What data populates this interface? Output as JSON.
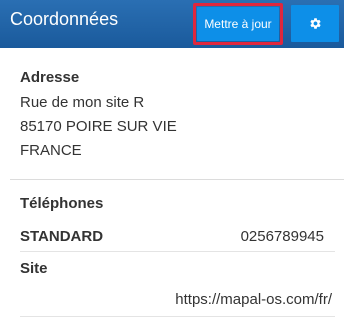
{
  "header": {
    "title": "Coordonnées",
    "update_label": "Mettre à jour",
    "settings_icon": "gear-icon"
  },
  "address": {
    "title": "Adresse",
    "lines": [
      "Rue de mon site R",
      "85170 POIRE SUR VIE",
      "FRANCE"
    ]
  },
  "phones": {
    "title": "Téléphones",
    "items": [
      {
        "label": "STANDARD",
        "value": "0256789945"
      }
    ]
  },
  "site": {
    "title": "Site",
    "url": "https://mapal-os.com/fr/"
  },
  "colors": {
    "header_bg": "#1f63a6",
    "button_bg": "#0d8fe8",
    "highlight": "#e0273d"
  }
}
